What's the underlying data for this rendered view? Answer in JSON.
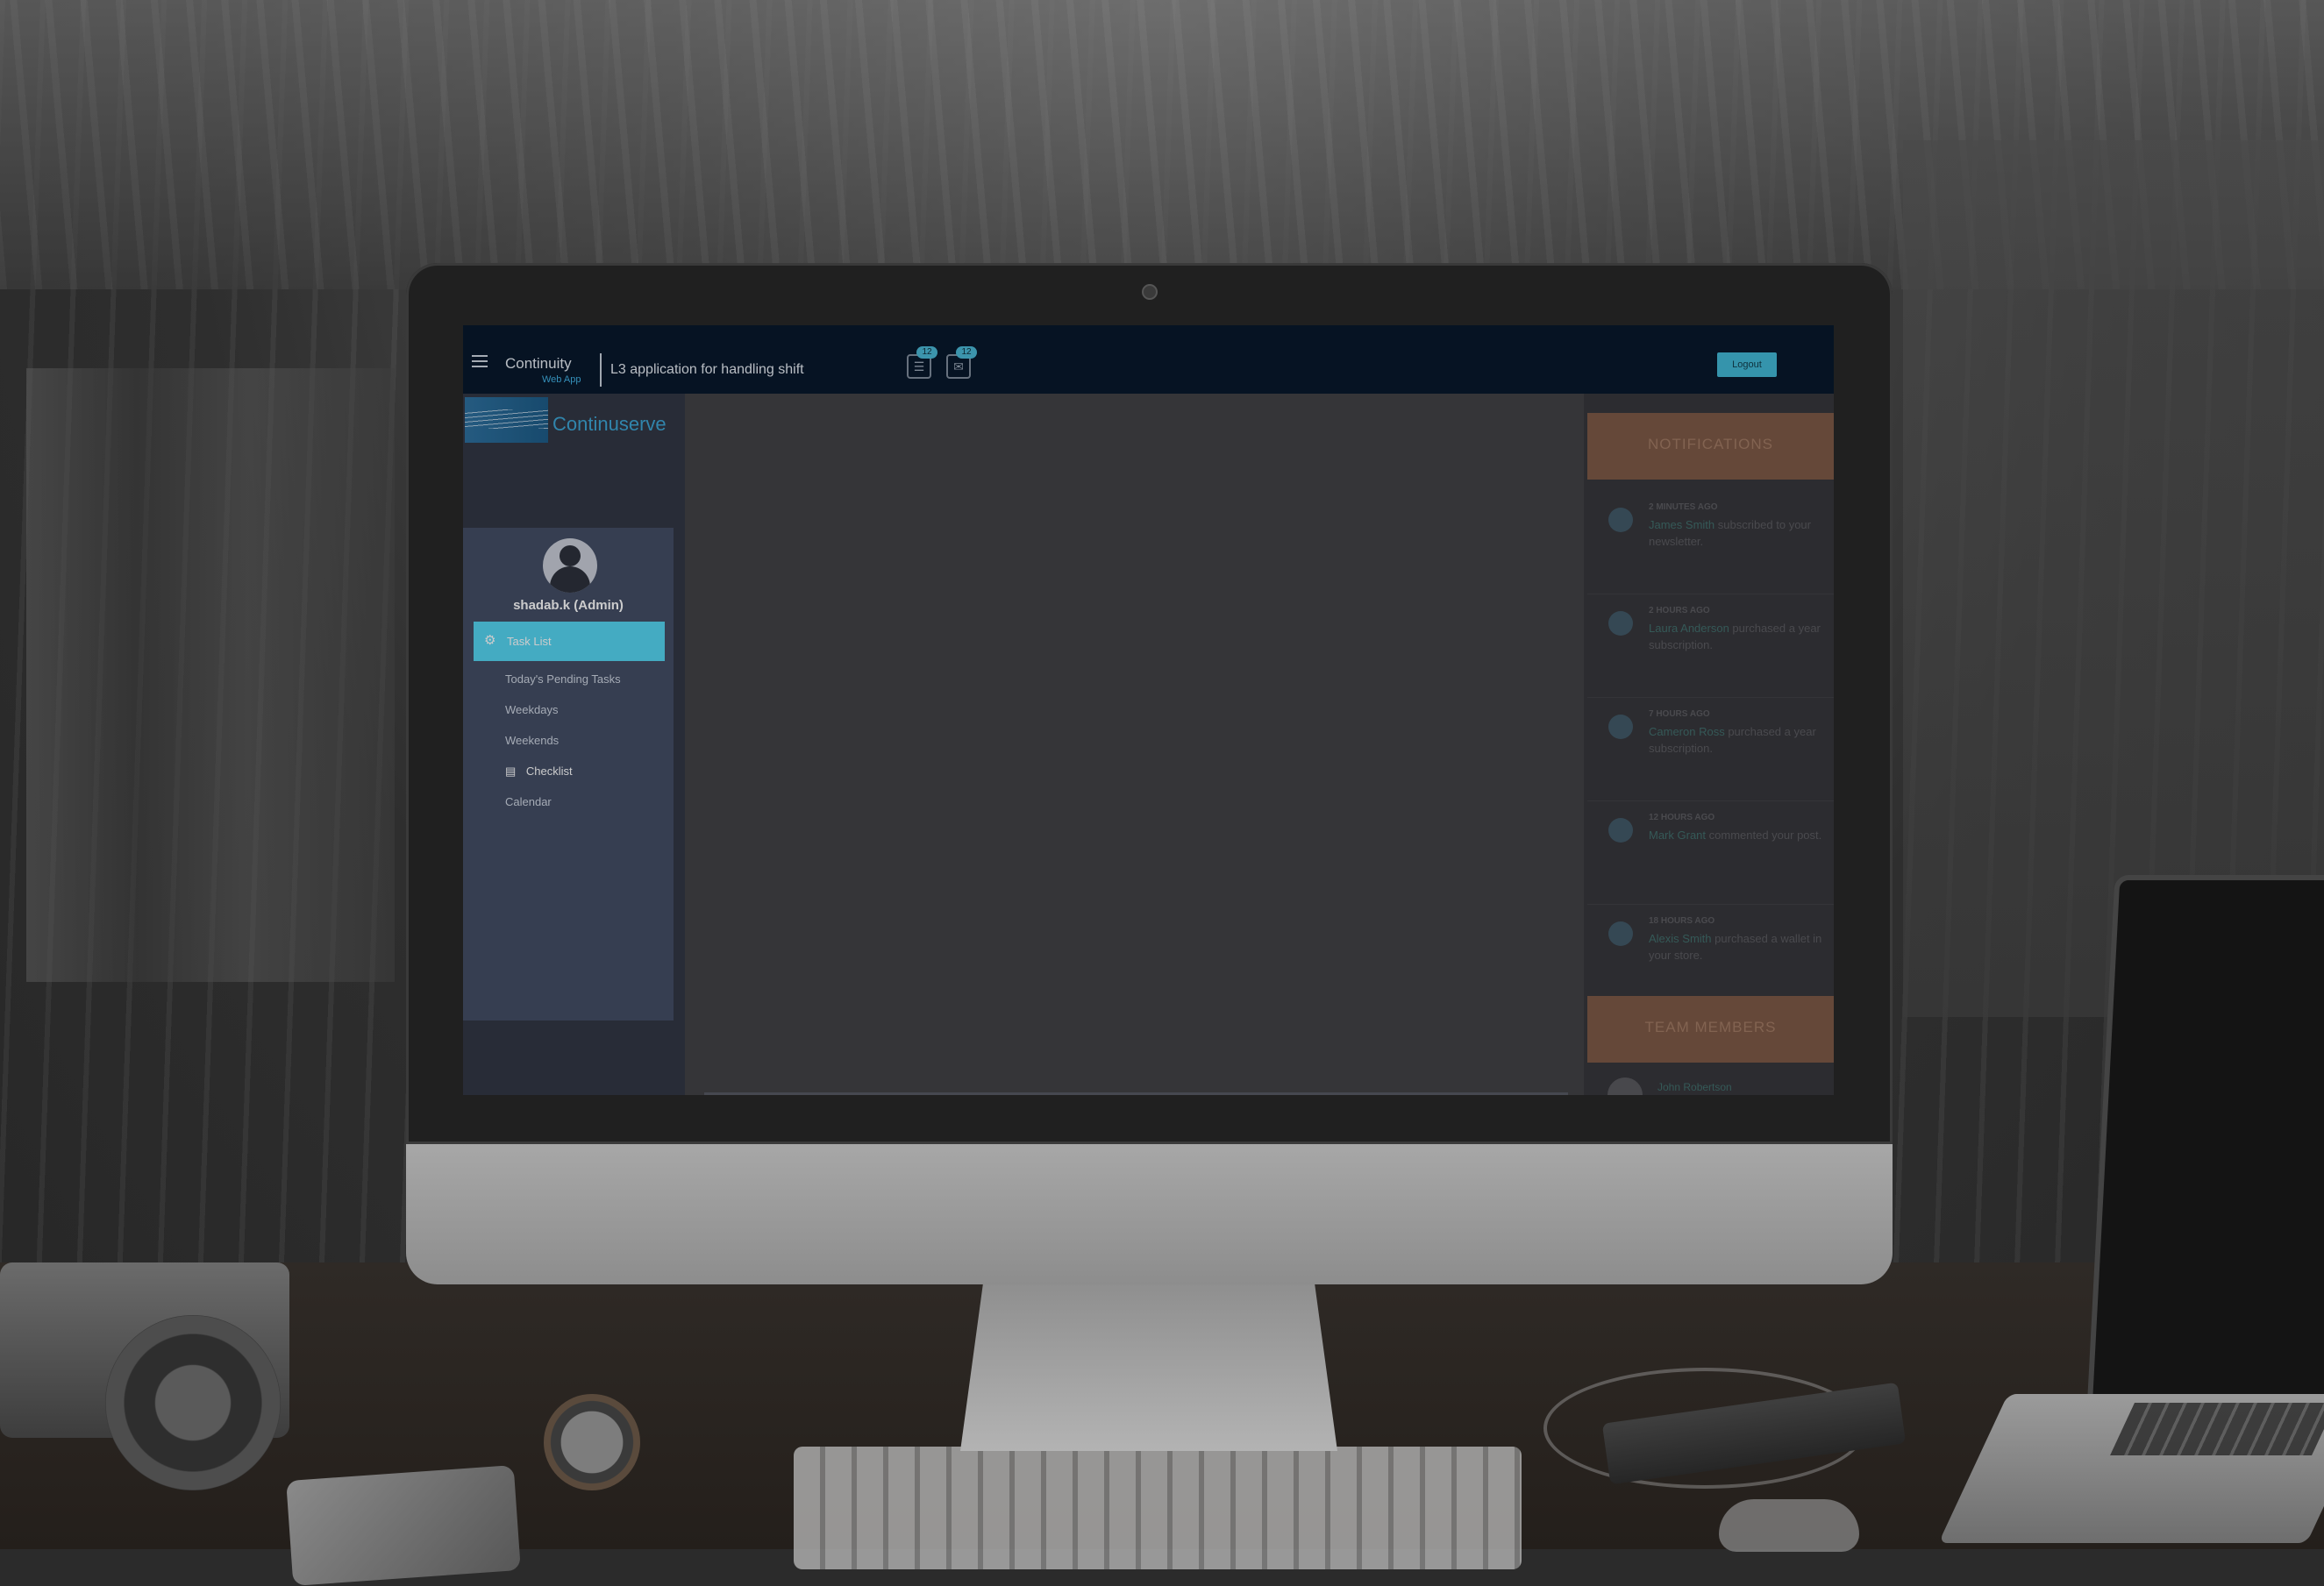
{
  "header": {
    "brand_name": "Continuity",
    "brand_sub": "Web App",
    "app_title": "L3 application for handling shift",
    "tasks_badge": "12",
    "mail_badge": "12",
    "logout_label": "Logout"
  },
  "sidebar": {
    "logo_text": "Continuserve",
    "username": "shadab.k (Admin)",
    "active_item": "Task List",
    "items": [
      {
        "label": "Today's Pending Tasks"
      },
      {
        "label": "Weekdays"
      },
      {
        "label": "Weekends"
      },
      {
        "label": "Checklist"
      },
      {
        "label": "Calendar"
      }
    ]
  },
  "notifications": {
    "title": "NOTIFICATIONS",
    "items": [
      {
        "time": "2 MINUTES AGO",
        "who": "James Smith",
        "text": "subscribed to your newsletter."
      },
      {
        "time": "2 HOURS AGO",
        "who": "Laura Anderson",
        "text": "purchased a year subscription."
      },
      {
        "time": "7 HOURS AGO",
        "who": "Cameron Ross",
        "text": "purchased a year subscription."
      },
      {
        "time": "12 HOURS AGO",
        "who": "Mark Grant",
        "text": "commented your post."
      },
      {
        "time": "18 HOURS AGO",
        "who": "Alexis Smith",
        "text": "purchased a wallet in your store."
      }
    ]
  },
  "team": {
    "title": "TEAM MEMBERS",
    "first_member": "John Robertson"
  },
  "colors": {
    "topbar": "#031427",
    "accent": "#53d7f3",
    "sidebar_panel": "#404b62",
    "notif_header": "#7d5843"
  },
  "icons": {
    "menu": "hamburger-icon",
    "tasks": "list-icon",
    "mail": "envelope-icon",
    "task_list": "gears-icon",
    "checklist": "book-icon",
    "apple": "apple-logo"
  }
}
